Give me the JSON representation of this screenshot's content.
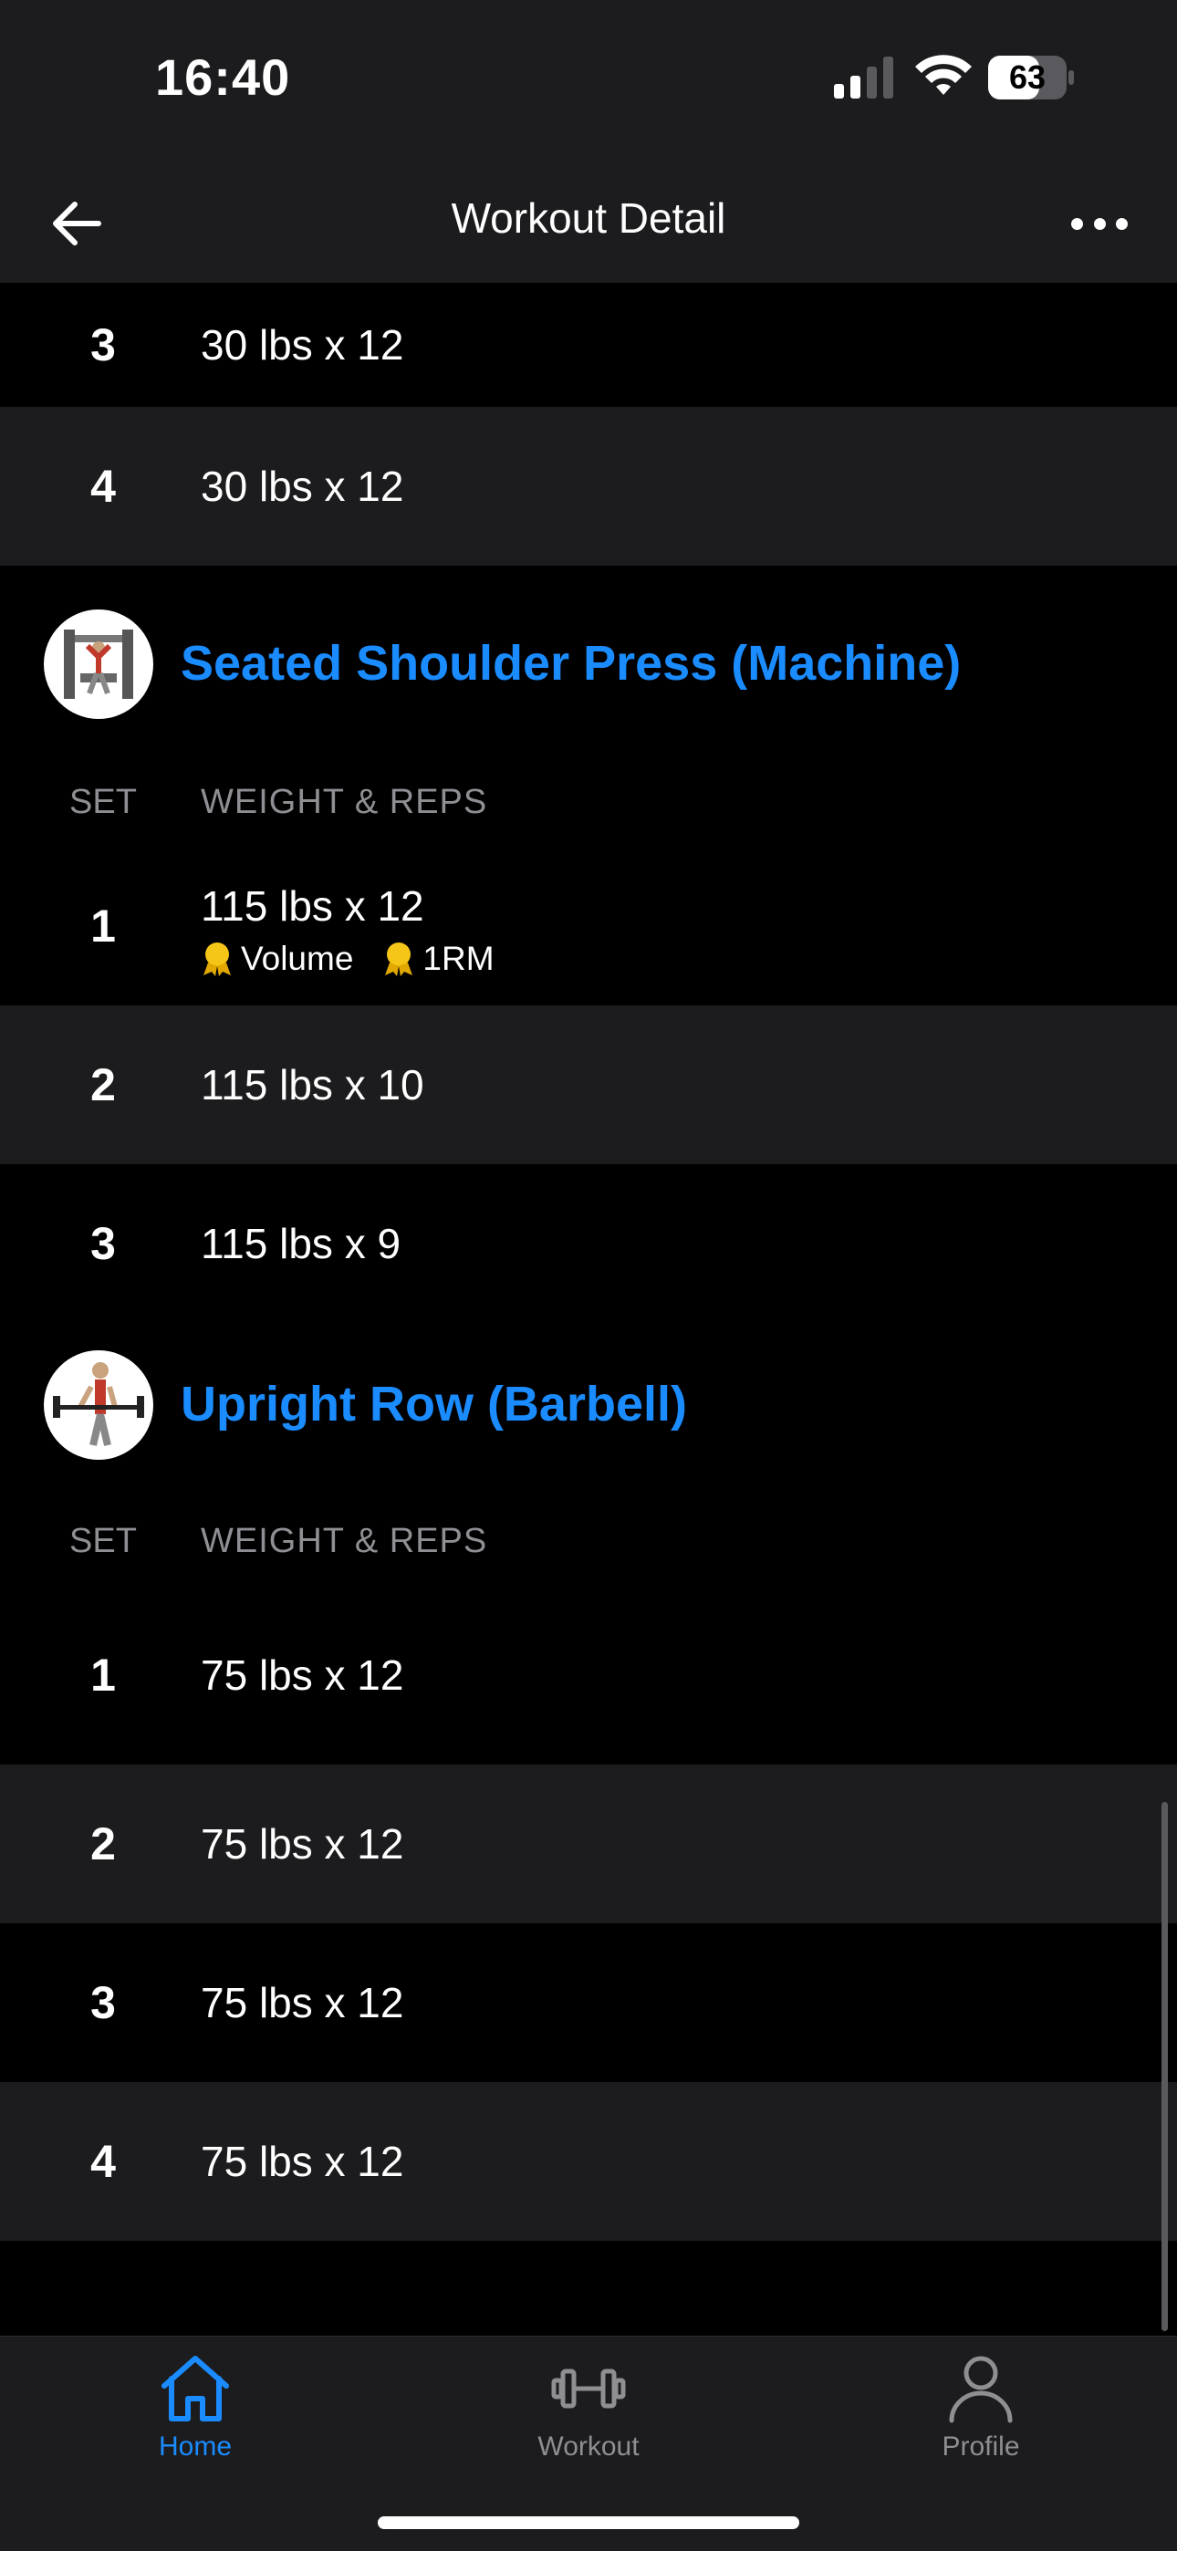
{
  "status_bar": {
    "time": "16:40",
    "battery": "63"
  },
  "header": {
    "title": "Workout Detail"
  },
  "colors": {
    "accent": "#1a8cff",
    "medal": "#f5c518",
    "row_alt": "#1c1c1e",
    "muted": "#8e8e93"
  },
  "previous_sets": [
    {
      "set": "3",
      "value": "30 lbs x 12",
      "alt": false
    },
    {
      "set": "4",
      "value": "30 lbs x 12",
      "alt": true
    }
  ],
  "exercises": [
    {
      "name": "Seated Shoulder Press (Machine)",
      "col_set": "SET",
      "col_weight_reps": "WEIGHT & REPS",
      "sets": [
        {
          "set": "1",
          "value": "115 lbs x 12",
          "badges": [
            "Volume",
            "1RM"
          ]
        },
        {
          "set": "2",
          "value": "115 lbs x 10"
        },
        {
          "set": "3",
          "value": "115 lbs x 9"
        }
      ]
    },
    {
      "name": "Upright Row (Barbell)",
      "col_set": "SET",
      "col_weight_reps": "WEIGHT & REPS",
      "sets": [
        {
          "set": "1",
          "value": "75 lbs x 12"
        },
        {
          "set": "2",
          "value": "75 lbs x 12"
        },
        {
          "set": "3",
          "value": "75 lbs x 12"
        },
        {
          "set": "4",
          "value": "75 lbs x 12"
        }
      ]
    }
  ],
  "tabs": [
    {
      "label": "Home",
      "icon": "home-icon",
      "active": true
    },
    {
      "label": "Workout",
      "icon": "dumbbell-icon",
      "active": false
    },
    {
      "label": "Profile",
      "icon": "person-icon",
      "active": false
    }
  ]
}
